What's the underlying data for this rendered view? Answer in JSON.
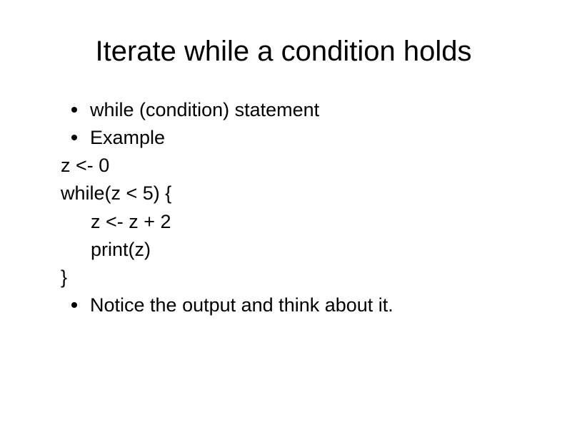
{
  "title": "Iterate while a condition holds",
  "lines": {
    "b1": "while (condition) statement",
    "b2": "Example",
    "l1": "z <- 0",
    "l2": "while(z < 5) {",
    "l3": "z <- z + 2",
    "l4": "print(z)",
    "l5": "}",
    "b3": "Notice the output and think about it."
  }
}
